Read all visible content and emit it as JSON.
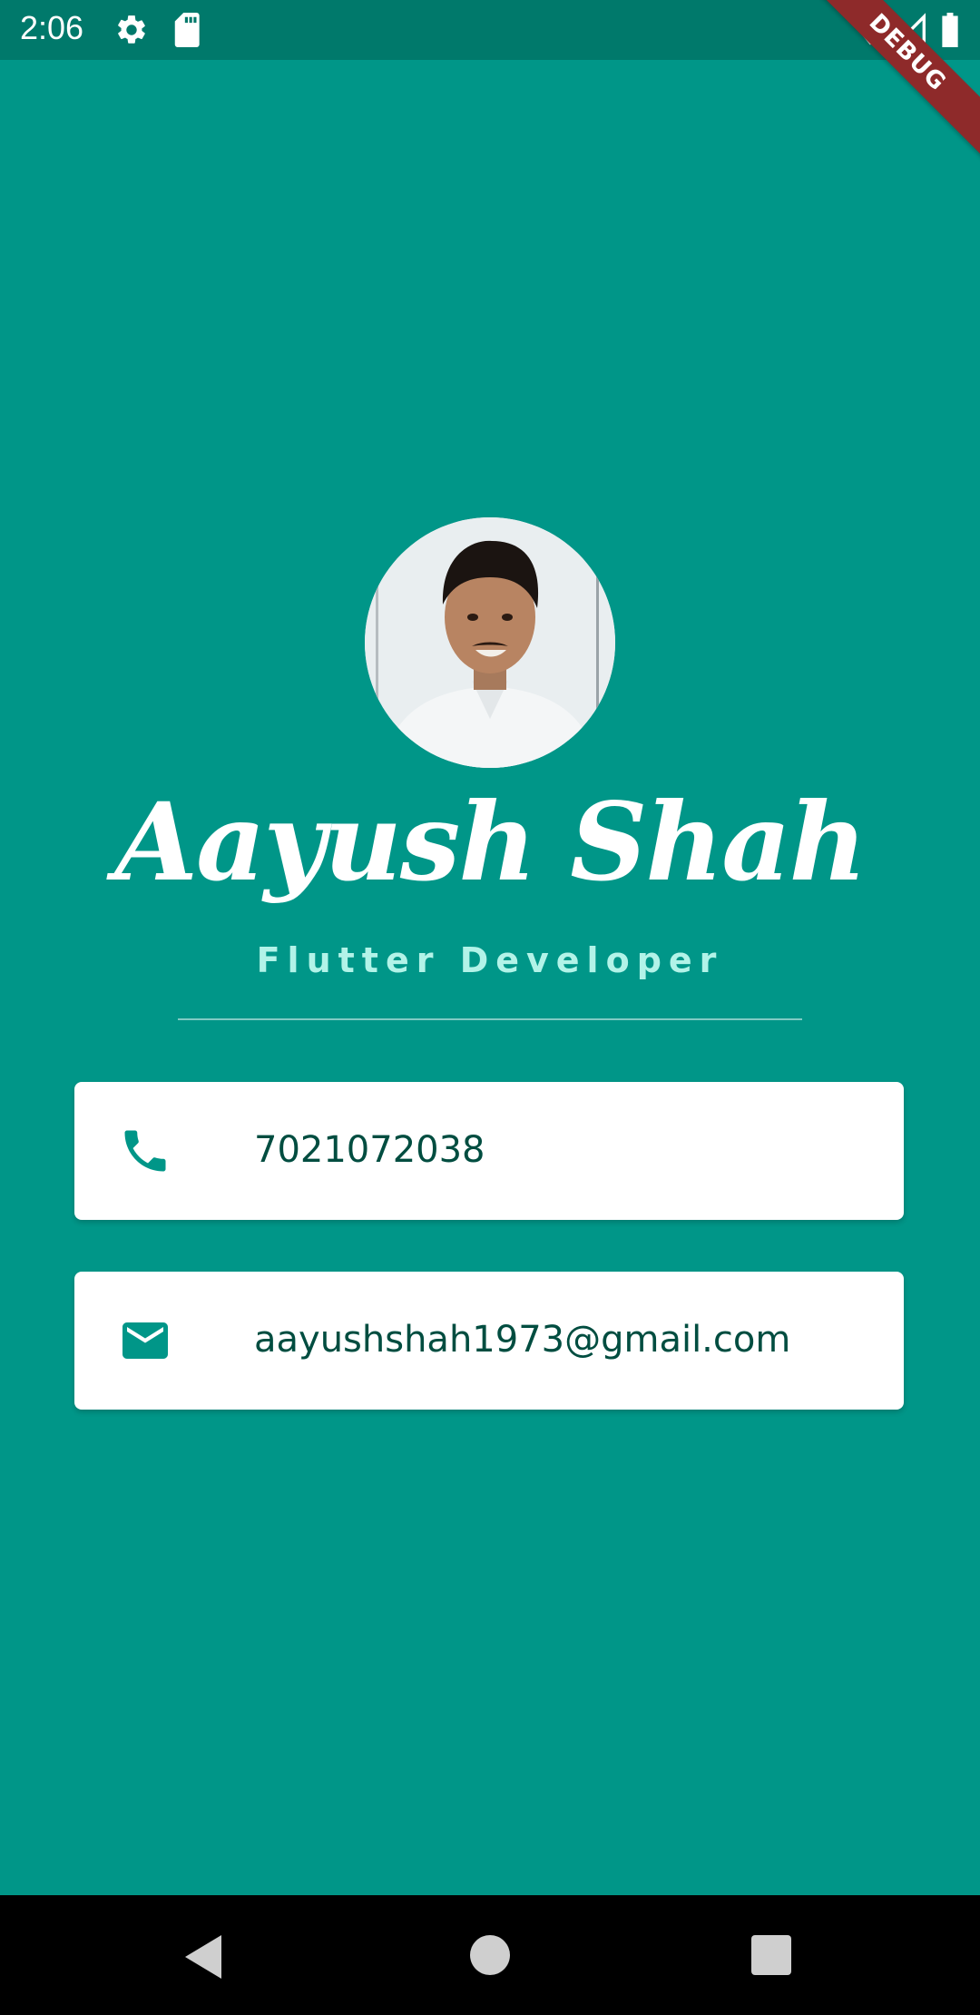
{
  "status_bar": {
    "time": "2:06",
    "left_icons": [
      "gear-icon",
      "sd-card-icon"
    ],
    "right_icons": [
      "wifi-icon",
      "signal-icon",
      "battery-icon"
    ]
  },
  "debug_banner": "DEBUG",
  "profile": {
    "name": "Aayush Shah",
    "title": "Flutter Developer"
  },
  "contacts": {
    "phone": {
      "icon": "phone-icon",
      "value": "7021072038"
    },
    "email": {
      "icon": "mail-icon",
      "value": "aayushshah1973@gmail.com"
    }
  },
  "nav_bar": {
    "buttons": [
      "back-icon",
      "home-icon",
      "recents-icon"
    ]
  },
  "colors": {
    "background": "#009688",
    "status_bar": "#00796B",
    "title_accent": "#B2F3E8",
    "card_text": "#004D40",
    "icon": "#009688"
  }
}
